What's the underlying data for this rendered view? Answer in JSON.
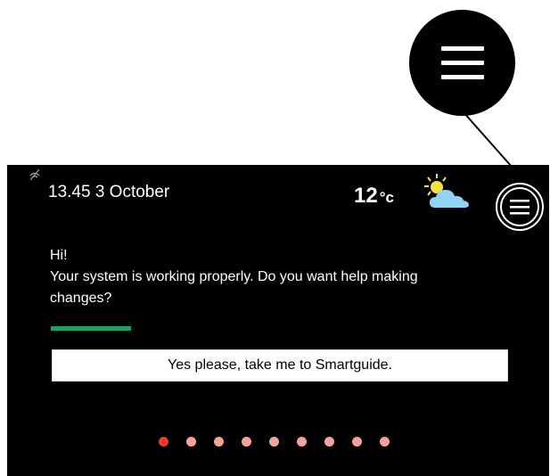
{
  "status": {
    "datetime": "13.45 3 October",
    "signal_icon": "signal-icon"
  },
  "weather": {
    "temperature": "12",
    "unit": "°c",
    "icon": "partly-sunny-icon",
    "sun_color": "#f6e33b",
    "cloud_color": "#8fd3f5"
  },
  "menu": {
    "icon": "hamburger-menu-icon"
  },
  "message": {
    "line1": "Hi!",
    "line2": "Your system is working properly. Do you want help making",
    "line3": "changes?"
  },
  "progress": {
    "color": "#19a463"
  },
  "smartguide_button": {
    "label": "Yes please, take me to Smartguide."
  },
  "pager": {
    "count": 9,
    "active_index": 0,
    "active_color": "#ef3b2c",
    "inactive_color": "#f4a39a"
  }
}
